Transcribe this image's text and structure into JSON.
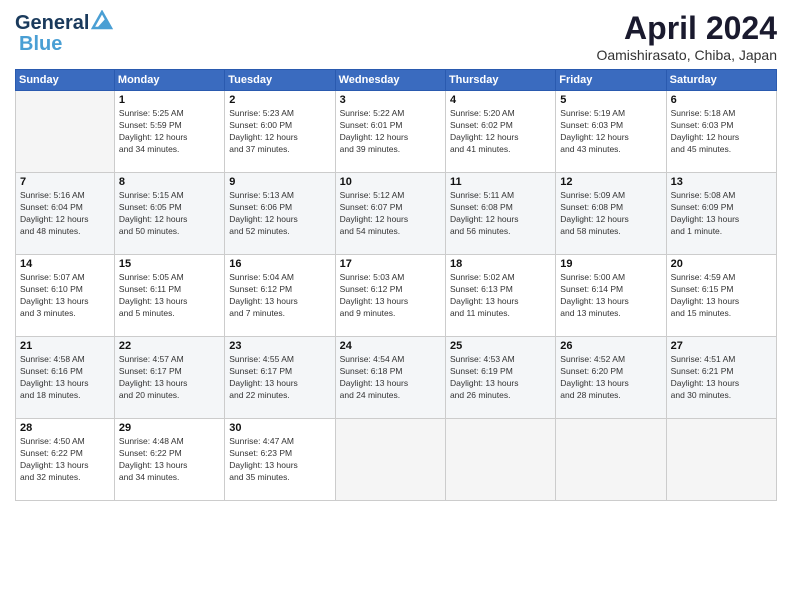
{
  "header": {
    "logo_line1": "General",
    "logo_line2": "Blue",
    "month_year": "April 2024",
    "location": "Oamishirasato, Chiba, Japan"
  },
  "days_of_week": [
    "Sunday",
    "Monday",
    "Tuesday",
    "Wednesday",
    "Thursday",
    "Friday",
    "Saturday"
  ],
  "weeks": [
    [
      {
        "day": "",
        "info": ""
      },
      {
        "day": "1",
        "info": "Sunrise: 5:25 AM\nSunset: 5:59 PM\nDaylight: 12 hours\nand 34 minutes."
      },
      {
        "day": "2",
        "info": "Sunrise: 5:23 AM\nSunset: 6:00 PM\nDaylight: 12 hours\nand 37 minutes."
      },
      {
        "day": "3",
        "info": "Sunrise: 5:22 AM\nSunset: 6:01 PM\nDaylight: 12 hours\nand 39 minutes."
      },
      {
        "day": "4",
        "info": "Sunrise: 5:20 AM\nSunset: 6:02 PM\nDaylight: 12 hours\nand 41 minutes."
      },
      {
        "day": "5",
        "info": "Sunrise: 5:19 AM\nSunset: 6:03 PM\nDaylight: 12 hours\nand 43 minutes."
      },
      {
        "day": "6",
        "info": "Sunrise: 5:18 AM\nSunset: 6:03 PM\nDaylight: 12 hours\nand 45 minutes."
      }
    ],
    [
      {
        "day": "7",
        "info": "Sunrise: 5:16 AM\nSunset: 6:04 PM\nDaylight: 12 hours\nand 48 minutes."
      },
      {
        "day": "8",
        "info": "Sunrise: 5:15 AM\nSunset: 6:05 PM\nDaylight: 12 hours\nand 50 minutes."
      },
      {
        "day": "9",
        "info": "Sunrise: 5:13 AM\nSunset: 6:06 PM\nDaylight: 12 hours\nand 52 minutes."
      },
      {
        "day": "10",
        "info": "Sunrise: 5:12 AM\nSunset: 6:07 PM\nDaylight: 12 hours\nand 54 minutes."
      },
      {
        "day": "11",
        "info": "Sunrise: 5:11 AM\nSunset: 6:08 PM\nDaylight: 12 hours\nand 56 minutes."
      },
      {
        "day": "12",
        "info": "Sunrise: 5:09 AM\nSunset: 6:08 PM\nDaylight: 12 hours\nand 58 minutes."
      },
      {
        "day": "13",
        "info": "Sunrise: 5:08 AM\nSunset: 6:09 PM\nDaylight: 13 hours\nand 1 minute."
      }
    ],
    [
      {
        "day": "14",
        "info": "Sunrise: 5:07 AM\nSunset: 6:10 PM\nDaylight: 13 hours\nand 3 minutes."
      },
      {
        "day": "15",
        "info": "Sunrise: 5:05 AM\nSunset: 6:11 PM\nDaylight: 13 hours\nand 5 minutes."
      },
      {
        "day": "16",
        "info": "Sunrise: 5:04 AM\nSunset: 6:12 PM\nDaylight: 13 hours\nand 7 minutes."
      },
      {
        "day": "17",
        "info": "Sunrise: 5:03 AM\nSunset: 6:12 PM\nDaylight: 13 hours\nand 9 minutes."
      },
      {
        "day": "18",
        "info": "Sunrise: 5:02 AM\nSunset: 6:13 PM\nDaylight: 13 hours\nand 11 minutes."
      },
      {
        "day": "19",
        "info": "Sunrise: 5:00 AM\nSunset: 6:14 PM\nDaylight: 13 hours\nand 13 minutes."
      },
      {
        "day": "20",
        "info": "Sunrise: 4:59 AM\nSunset: 6:15 PM\nDaylight: 13 hours\nand 15 minutes."
      }
    ],
    [
      {
        "day": "21",
        "info": "Sunrise: 4:58 AM\nSunset: 6:16 PM\nDaylight: 13 hours\nand 18 minutes."
      },
      {
        "day": "22",
        "info": "Sunrise: 4:57 AM\nSunset: 6:17 PM\nDaylight: 13 hours\nand 20 minutes."
      },
      {
        "day": "23",
        "info": "Sunrise: 4:55 AM\nSunset: 6:17 PM\nDaylight: 13 hours\nand 22 minutes."
      },
      {
        "day": "24",
        "info": "Sunrise: 4:54 AM\nSunset: 6:18 PM\nDaylight: 13 hours\nand 24 minutes."
      },
      {
        "day": "25",
        "info": "Sunrise: 4:53 AM\nSunset: 6:19 PM\nDaylight: 13 hours\nand 26 minutes."
      },
      {
        "day": "26",
        "info": "Sunrise: 4:52 AM\nSunset: 6:20 PM\nDaylight: 13 hours\nand 28 minutes."
      },
      {
        "day": "27",
        "info": "Sunrise: 4:51 AM\nSunset: 6:21 PM\nDaylight: 13 hours\nand 30 minutes."
      }
    ],
    [
      {
        "day": "28",
        "info": "Sunrise: 4:50 AM\nSunset: 6:22 PM\nDaylight: 13 hours\nand 32 minutes."
      },
      {
        "day": "29",
        "info": "Sunrise: 4:48 AM\nSunset: 6:22 PM\nDaylight: 13 hours\nand 34 minutes."
      },
      {
        "day": "30",
        "info": "Sunrise: 4:47 AM\nSunset: 6:23 PM\nDaylight: 13 hours\nand 35 minutes."
      },
      {
        "day": "",
        "info": ""
      },
      {
        "day": "",
        "info": ""
      },
      {
        "day": "",
        "info": ""
      },
      {
        "day": "",
        "info": ""
      }
    ]
  ]
}
